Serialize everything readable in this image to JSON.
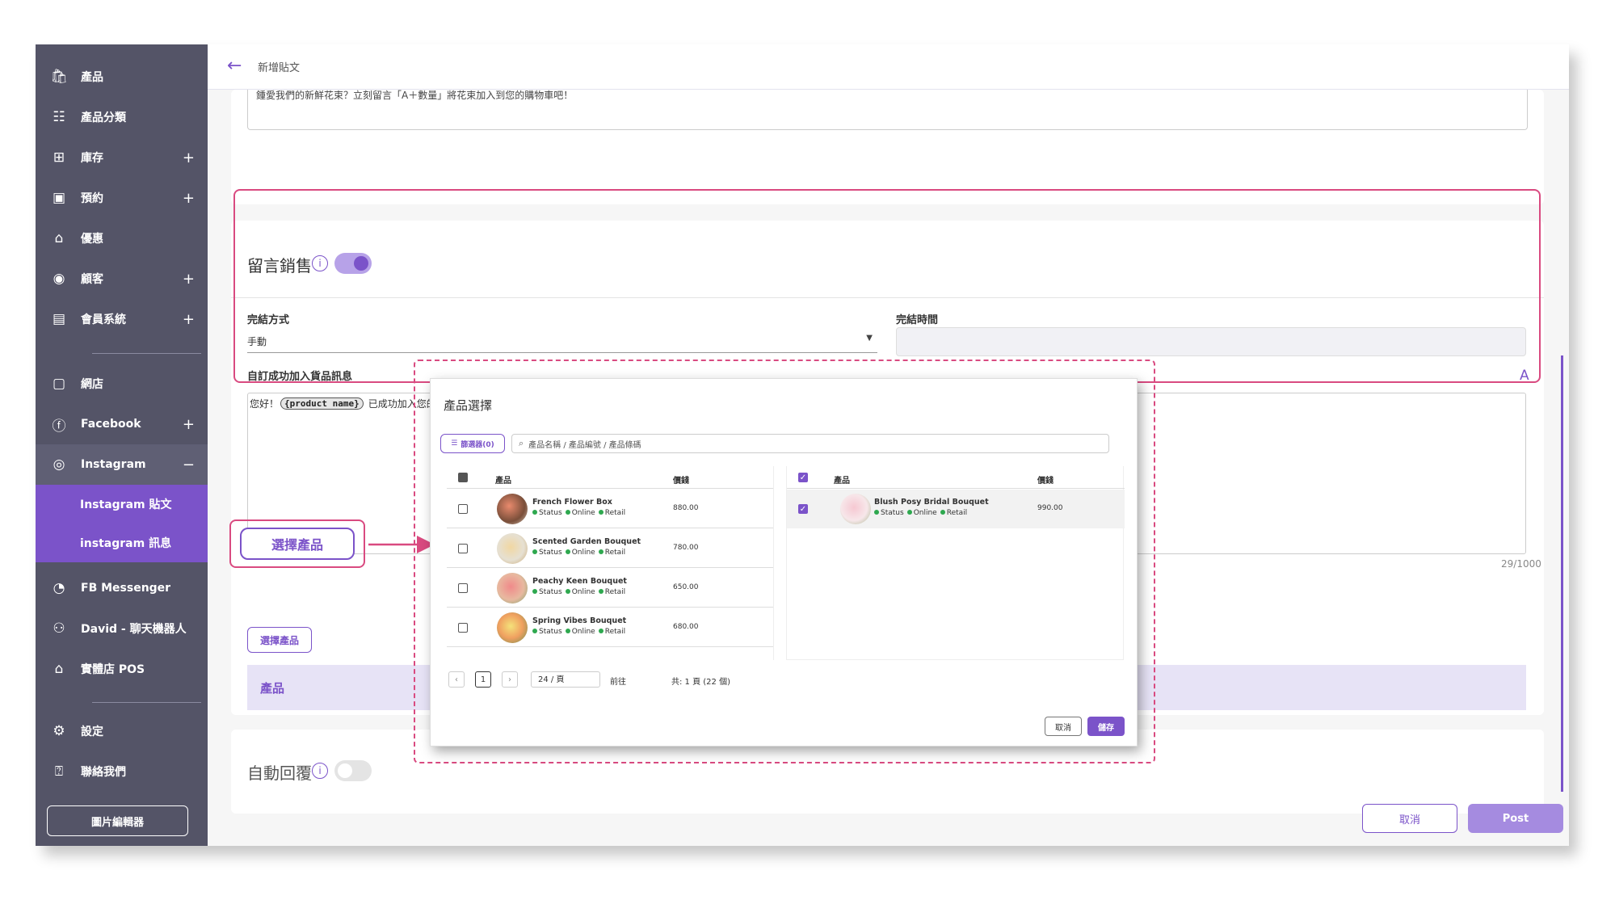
{
  "sidebar": {
    "items": [
      {
        "label": "產品",
        "icon": "shopping-bag-icon",
        "glyph": "🛍",
        "plus": ""
      },
      {
        "label": "產品分類",
        "icon": "list-icon",
        "glyph": "☷",
        "plus": ""
      },
      {
        "label": "庫存",
        "icon": "inventory-icon",
        "glyph": "⊞",
        "plus": "+"
      },
      {
        "label": "預約",
        "icon": "calendar-icon",
        "glyph": "▣",
        "plus": "+"
      },
      {
        "label": "優惠",
        "icon": "home-icon",
        "glyph": "⌂",
        "plus": ""
      },
      {
        "label": "顧客",
        "icon": "user-icon",
        "glyph": "◉",
        "plus": "+"
      },
      {
        "label": "會員系統",
        "icon": "member-icon",
        "glyph": "▤",
        "plus": "+"
      },
      {
        "label": "網店",
        "icon": "store-icon",
        "glyph": "▢",
        "plus": ""
      },
      {
        "label": "Facebook",
        "icon": "facebook-icon",
        "glyph": "ⓕ",
        "plus": "+"
      },
      {
        "label": "Instagram",
        "icon": "instagram-icon",
        "glyph": "◎",
        "plus": "−"
      },
      {
        "label": "FB Messenger",
        "icon": "messenger-icon",
        "glyph": "◔",
        "plus": ""
      },
      {
        "label": "David - 聊天機器人",
        "icon": "bot-icon",
        "glyph": "⚇",
        "plus": ""
      },
      {
        "label": "實體店 POS",
        "icon": "pos-icon",
        "glyph": "⌂",
        "plus": ""
      },
      {
        "label": "設定",
        "icon": "gear-icon",
        "glyph": "⚙",
        "plus": ""
      },
      {
        "label": "聯絡我們",
        "icon": "help-icon",
        "glyph": "⍰",
        "plus": ""
      }
    ],
    "sub_items": [
      "Instagram 貼文",
      "instagram 訊息"
    ],
    "image_editor": "圖片編輯器"
  },
  "header": {
    "title": "新增貼文"
  },
  "post_text_snippet": "鍾愛我們的新鮮花束？立刻留言「A＋數量」將花束加入到您的購物車吧！",
  "comment_sale": {
    "title": "留言銷售",
    "enabled": true,
    "end_method_label": "完結方式",
    "end_method_value": "手動",
    "end_time_label": "完結時間",
    "custom_msg_label": "自訂成功加入貨品訊息",
    "custom_msg_prefix": "您好！",
    "custom_msg_tag": "{product name}",
    "custom_msg_suffix": "已成功加入您的購物車。",
    "font_icon_label": "A",
    "char_count": "29/1000"
  },
  "select_product_button": "選擇產品",
  "product_header": "產品",
  "auto_reply": {
    "title": "自動回覆",
    "enabled": false
  },
  "footer": {
    "cancel": "取消",
    "post": "Post"
  },
  "colors": {
    "accent": "#7b53c9",
    "highlight": "#d94a80",
    "sidebar": "#545467"
  },
  "modal": {
    "title": "產品選擇",
    "filter_button": "篩選器(0)",
    "search_placeholder": "產品名稱 / 產品編號 / 產品條碼",
    "col_product": "產品",
    "col_price": "價錢",
    "products": [
      {
        "name": "French Flower Box",
        "price": "880.00"
      },
      {
        "name": "Scented Garden Bouquet",
        "price": "780.00"
      },
      {
        "name": "Peachy Keen Bouquet",
        "price": "650.00"
      },
      {
        "name": "Spring Vibes Bouquet",
        "price": "680.00"
      }
    ],
    "status_labels": [
      "Status",
      "Online",
      "Retail"
    ],
    "selected": [
      {
        "name": "Blush Posy Bridal Bouquet",
        "price": "990.00"
      }
    ],
    "pagination": {
      "prev": "‹",
      "page": "1",
      "next": "›",
      "per_page": "24 / 頁",
      "goto": "前往",
      "total": "共: 1 頁 (22 個)"
    },
    "cancel": "取消",
    "save": "儲存"
  }
}
